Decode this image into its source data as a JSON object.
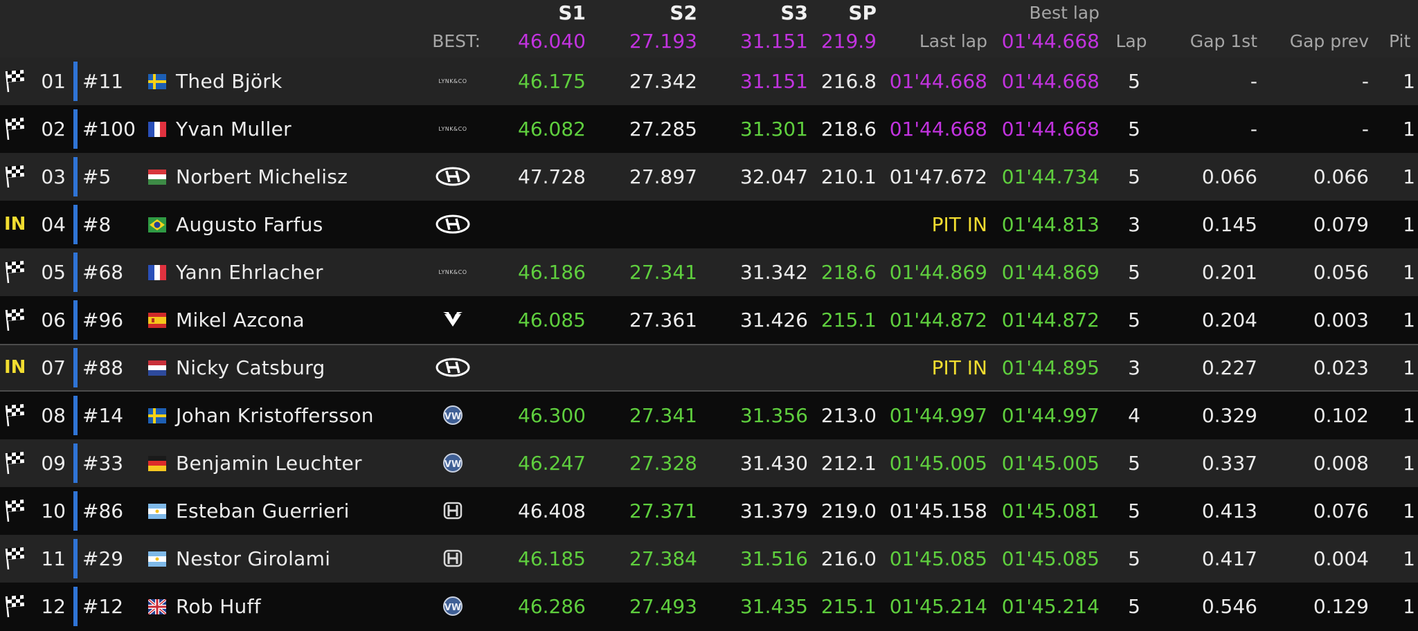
{
  "header": {
    "s1": "S1",
    "s2": "S2",
    "s3": "S3",
    "sp": "SP",
    "best_lap_top": "Best lap",
    "best_label": "BEST:",
    "best_s1": "46.040",
    "best_s2": "27.193",
    "best_s3": "31.151",
    "best_sp": "219.9",
    "last_lap": "Last lap",
    "best_lap": "01'44.668",
    "lap": "Lap",
    "gap_first": "Gap 1st",
    "gap_prev": "Gap prev",
    "pit": "Pit"
  },
  "colors": {
    "green": "#5fcf3e",
    "purple": "#c233df",
    "yellow": "#f2dd30",
    "team_bar": "#2f74d6"
  },
  "rows": [
    {
      "status": "flag",
      "pos": "01",
      "num": "#11",
      "country": "SE",
      "name": "Thed Björk",
      "make": "LYNK&CO",
      "s1": "46.175",
      "s1_c": "green",
      "s2": "27.342",
      "s2_c": "white",
      "s3": "31.151",
      "s3_c": "purple",
      "sp": "216.8",
      "sp_c": "white",
      "last": "01'44.668",
      "last_c": "purple",
      "best": "01'44.668",
      "best_c": "purple",
      "lap": "5",
      "gap1": "-",
      "gapp": "-",
      "pit": "1"
    },
    {
      "status": "flag",
      "pos": "02",
      "num": "#100",
      "country": "FR",
      "name": "Yvan Muller",
      "make": "LYNK&CO",
      "s1": "46.082",
      "s1_c": "green",
      "s2": "27.285",
      "s2_c": "white",
      "s3": "31.301",
      "s3_c": "green",
      "sp": "218.6",
      "sp_c": "white",
      "last": "01'44.668",
      "last_c": "purple",
      "best": "01'44.668",
      "best_c": "purple",
      "lap": "5",
      "gap1": "-",
      "gapp": "-",
      "pit": "1"
    },
    {
      "status": "flag",
      "pos": "03",
      "num": "#5",
      "country": "HU",
      "name": "Norbert Michelisz",
      "make": "HYUNDAI",
      "s1": "47.728",
      "s1_c": "white",
      "s2": "27.897",
      "s2_c": "white",
      "s3": "32.047",
      "s3_c": "white",
      "sp": "210.1",
      "sp_c": "white",
      "last": "01'47.672",
      "last_c": "white",
      "best": "01'44.734",
      "best_c": "green",
      "lap": "5",
      "gap1": "0.066",
      "gapp": "0.066",
      "pit": "1"
    },
    {
      "status": "IN",
      "pos": "04",
      "num": "#8",
      "country": "BR",
      "name": "Augusto Farfus",
      "make": "HYUNDAI",
      "s1": "",
      "s1_c": "white",
      "s2": "",
      "s2_c": "white",
      "s3": "",
      "s3_c": "white",
      "sp": "",
      "sp_c": "white",
      "last": "PIT IN",
      "last_c": "yellow",
      "best": "01'44.813",
      "best_c": "green",
      "lap": "3",
      "gap1": "0.145",
      "gapp": "0.079",
      "pit": "1"
    },
    {
      "status": "flag",
      "pos": "05",
      "num": "#68",
      "country": "FR",
      "name": "Yann Ehrlacher",
      "make": "LYNK&CO",
      "s1": "46.186",
      "s1_c": "green",
      "s2": "27.341",
      "s2_c": "green",
      "s3": "31.342",
      "s3_c": "white",
      "sp": "218.6",
      "sp_c": "green",
      "last": "01'44.869",
      "last_c": "green",
      "best": "01'44.869",
      "best_c": "green",
      "lap": "5",
      "gap1": "0.201",
      "gapp": "0.056",
      "pit": "1"
    },
    {
      "status": "flag",
      "pos": "06",
      "num": "#96",
      "country": "ES",
      "name": "Mikel Azcona",
      "make": "CUPRA",
      "s1": "46.085",
      "s1_c": "green",
      "s2": "27.361",
      "s2_c": "white",
      "s3": "31.426",
      "s3_c": "white",
      "sp": "215.1",
      "sp_c": "green",
      "last": "01'44.872",
      "last_c": "green",
      "best": "01'44.872",
      "best_c": "green",
      "lap": "5",
      "gap1": "0.204",
      "gapp": "0.003",
      "pit": "1"
    },
    {
      "status": "IN",
      "pos": "07",
      "num": "#88",
      "country": "NL",
      "name": "Nicky Catsburg",
      "make": "HYUNDAI",
      "s1": "",
      "s1_c": "white",
      "s2": "",
      "s2_c": "white",
      "s3": "",
      "s3_c": "white",
      "sp": "",
      "sp_c": "white",
      "last": "PIT IN",
      "last_c": "yellow",
      "best": "01'44.895",
      "best_c": "green",
      "lap": "3",
      "gap1": "0.227",
      "gapp": "0.023",
      "pit": "1"
    },
    {
      "status": "flag",
      "pos": "08",
      "num": "#14",
      "country": "SE",
      "name": "Johan Kristoffersson",
      "make": "VW",
      "s1": "46.300",
      "s1_c": "green",
      "s2": "27.341",
      "s2_c": "green",
      "s3": "31.356",
      "s3_c": "green",
      "sp": "213.0",
      "sp_c": "white",
      "last": "01'44.997",
      "last_c": "green",
      "best": "01'44.997",
      "best_c": "green",
      "lap": "4",
      "gap1": "0.329",
      "gapp": "0.102",
      "pit": "1"
    },
    {
      "status": "flag",
      "pos": "09",
      "num": "#33",
      "country": "DE",
      "name": "Benjamin Leuchter",
      "make": "VW",
      "s1": "46.247",
      "s1_c": "green",
      "s2": "27.328",
      "s2_c": "green",
      "s3": "31.430",
      "s3_c": "white",
      "sp": "212.1",
      "sp_c": "white",
      "last": "01'45.005",
      "last_c": "green",
      "best": "01'45.005",
      "best_c": "green",
      "lap": "5",
      "gap1": "0.337",
      "gapp": "0.008",
      "pit": "1"
    },
    {
      "status": "flag",
      "pos": "10",
      "num": "#86",
      "country": "AR",
      "name": "Esteban Guerrieri",
      "make": "HONDA",
      "s1": "46.408",
      "s1_c": "white",
      "s2": "27.371",
      "s2_c": "green",
      "s3": "31.379",
      "s3_c": "white",
      "sp": "219.0",
      "sp_c": "white",
      "last": "01'45.158",
      "last_c": "white",
      "best": "01'45.081",
      "best_c": "green",
      "lap": "5",
      "gap1": "0.413",
      "gapp": "0.076",
      "pit": "1"
    },
    {
      "status": "flag",
      "pos": "11",
      "num": "#29",
      "country": "AR",
      "name": "Nestor Girolami",
      "make": "HONDA",
      "s1": "46.185",
      "s1_c": "green",
      "s2": "27.384",
      "s2_c": "green",
      "s3": "31.516",
      "s3_c": "green",
      "sp": "216.0",
      "sp_c": "white",
      "last": "01'45.085",
      "last_c": "green",
      "best": "01'45.085",
      "best_c": "green",
      "lap": "5",
      "gap1": "0.417",
      "gapp": "0.004",
      "pit": "1"
    },
    {
      "status": "flag",
      "pos": "12",
      "num": "#12",
      "country": "GB",
      "name": "Rob Huff",
      "make": "VW",
      "s1": "46.286",
      "s1_c": "green",
      "s2": "27.493",
      "s2_c": "green",
      "s3": "31.435",
      "s3_c": "green",
      "sp": "215.1",
      "sp_c": "green",
      "last": "01'45.214",
      "last_c": "green",
      "best": "01'45.214",
      "best_c": "green",
      "lap": "5",
      "gap1": "0.546",
      "gapp": "0.129",
      "pit": "1"
    }
  ]
}
